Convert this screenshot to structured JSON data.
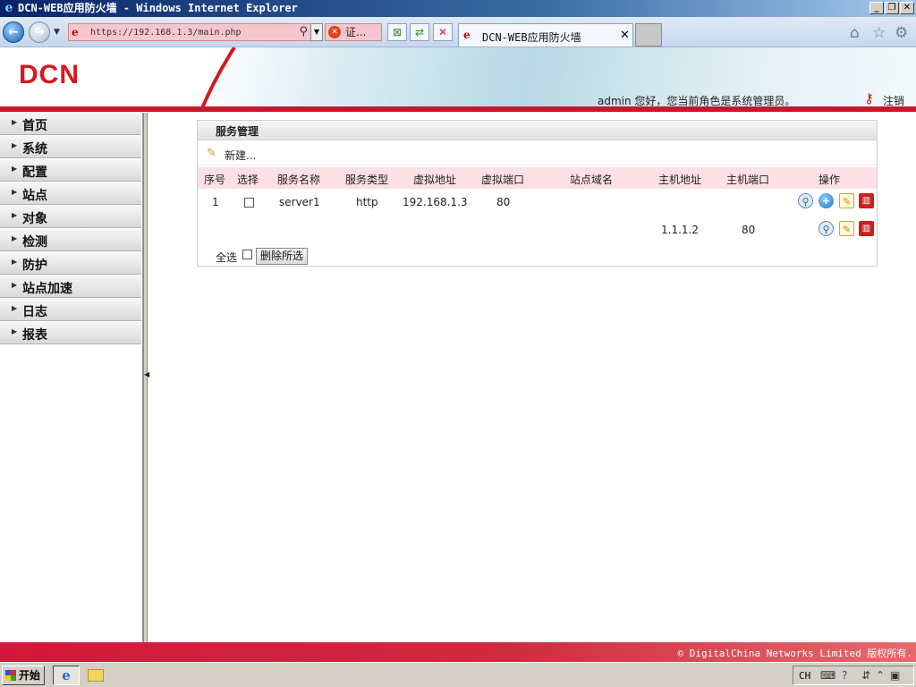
{
  "window": {
    "title": "DCN-WEB应用防火墙 - Windows Internet Explorer",
    "minimize_glyph": "_",
    "maximize_glyph": "❐",
    "close_glyph": "✕"
  },
  "browser": {
    "url": "https://192.168.1.3/main.php",
    "cert_error_label": "证...",
    "tab_title": "DCN-WEB应用防火墙",
    "tab_close": "✕"
  },
  "header": {
    "logo_text": "DCN",
    "user_info": "admin 您好，您当前角色是系统管理员。",
    "logout_label": "注销"
  },
  "sidebar": {
    "items": [
      {
        "label": "首页"
      },
      {
        "label": "系统"
      },
      {
        "label": "配置"
      },
      {
        "label": "站点"
      },
      {
        "label": "对象"
      },
      {
        "label": "检测"
      },
      {
        "label": "防护"
      },
      {
        "label": "站点加速"
      },
      {
        "label": "日志"
      },
      {
        "label": "报表"
      }
    ]
  },
  "panel": {
    "title": "服务管理",
    "new_label": "新建...",
    "columns": [
      "序号",
      "选择",
      "服务名称",
      "服务类型",
      "虚拟地址",
      "虚拟端口",
      "站点域名",
      "主机地址",
      "主机端口",
      "操作"
    ],
    "rows": [
      {
        "index": "1",
        "name": "server1",
        "type": "http",
        "vaddr": "192.168.1.3",
        "vport": "80",
        "domain": "",
        "host": "",
        "hport": ""
      },
      {
        "index": "",
        "name": "",
        "type": "",
        "vaddr": "",
        "vport": "",
        "domain": "",
        "host": "1.1.1.2",
        "hport": "80"
      }
    ],
    "select_all_label": "全选",
    "delete_selected_label": "删除所选"
  },
  "footer": {
    "copyright": "© DigitalChina Networks Limited 版权所有."
  },
  "taskbar": {
    "start_label": "开始",
    "lang": "CH"
  }
}
